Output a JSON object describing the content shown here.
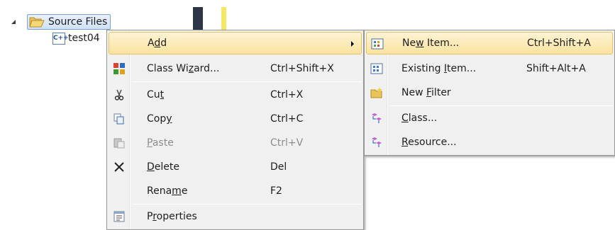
{
  "tree": {
    "folder_label": "Source Files",
    "file_label": "test04",
    "file_icon_text": "C++"
  },
  "context_menu": {
    "items": [
      {
        "pre": "A",
        "u": "d",
        "post": "d",
        "shortcut": "",
        "icon": "none",
        "submenu": true,
        "state": "highlighted"
      },
      {
        "pre": "Class Wi",
        "u": "z",
        "post": "ard...",
        "shortcut": "Ctrl+Shift+X",
        "icon": "class-wizard-icon",
        "state": "normal"
      },
      {
        "pre": "Cu",
        "u": "t",
        "post": "",
        "shortcut": "Ctrl+X",
        "icon": "scissors-icon",
        "state": "normal"
      },
      {
        "pre": "Cop",
        "u": "y",
        "post": "",
        "shortcut": "Ctrl+C",
        "icon": "copy-icon",
        "state": "normal"
      },
      {
        "pre": "",
        "u": "P",
        "post": "aste",
        "shortcut": "Ctrl+V",
        "icon": "paste-icon",
        "state": "disabled"
      },
      {
        "pre": "",
        "u": "D",
        "post": "elete",
        "shortcut": "Del",
        "icon": "delete-icon",
        "state": "normal"
      },
      {
        "pre": "Rena",
        "u": "m",
        "post": "e",
        "shortcut": "F2",
        "icon": "none",
        "state": "normal"
      },
      {
        "pre": "P",
        "u": "r",
        "post": "operties",
        "shortcut": "",
        "icon": "properties-icon",
        "state": "normal"
      }
    ]
  },
  "add_submenu": {
    "items": [
      {
        "pre": "Ne",
        "u": "w",
        "post": " Item...",
        "shortcut": "Ctrl+Shift+A",
        "icon": "new-item-icon",
        "state": "highlighted"
      },
      {
        "pre": "Existing ",
        "u": "I",
        "post": "tem...",
        "shortcut": "Shift+Alt+A",
        "icon": "existing-item-icon",
        "state": "normal"
      },
      {
        "pre": "New ",
        "u": "F",
        "post": "ilter",
        "shortcut": "",
        "icon": "new-filter-icon",
        "state": "normal"
      },
      {
        "pre": "",
        "u": "C",
        "post": "lass...",
        "shortcut": "",
        "icon": "class-icon",
        "state": "normal"
      },
      {
        "pre": "",
        "u": "R",
        "post": "esource...",
        "shortcut": "",
        "icon": "resource-icon",
        "state": "normal"
      }
    ]
  },
  "colors": {
    "highlight_top": "#fdf3d4",
    "highlight_bottom": "#fbe39f",
    "disabled_text": "#8d8d8d"
  }
}
